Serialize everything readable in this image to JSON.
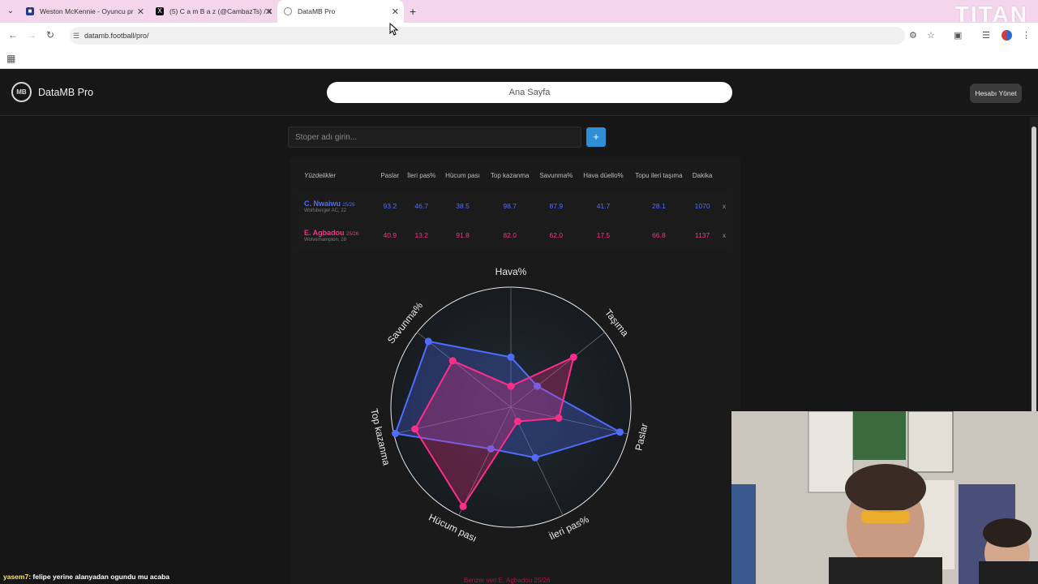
{
  "browser": {
    "tabs": [
      {
        "title": "Weston McKennie - Oyuncu pr",
        "active": false
      },
      {
        "title": "(5) C a m B a z (@CambazTs) / X",
        "active": false
      },
      {
        "title": "DataMB Pro",
        "active": true
      }
    ],
    "url": "datamb.football/pro/",
    "watermark": "TITAN"
  },
  "app": {
    "brand": "DataMB Pro",
    "logo_text": "MB",
    "home_button": "Ana Sayfa",
    "account_button": "Hesabı Yönet",
    "search_placeholder": "Stoper adı girin...",
    "add_button": "+"
  },
  "table": {
    "header_first": "Yüzdelikler",
    "columns": [
      "Paslar",
      "İleri pas%",
      "Hücum pası",
      "Top kazanma",
      "Savunma%",
      "Hava düello%",
      "Topu ileri taşıma",
      "Dakika"
    ],
    "players": [
      {
        "name": "C. Nwaiwu",
        "season": "25/26",
        "club": "Wolfsberger AC, 22",
        "values": [
          "93.2",
          "46.7",
          "38.5",
          "98.7",
          "87.9",
          "41.7",
          "28.1",
          "1070"
        ],
        "color": "#4f6cff"
      },
      {
        "name": "E. Agbadou",
        "season": "25/26",
        "club": "Wolverhampton, 28",
        "values": [
          "40.9",
          "13.2",
          "91.8",
          "82.0",
          "62.0",
          "17.5",
          "66.8",
          "1137"
        ],
        "color": "#ff2d8a"
      }
    ],
    "remove_label": "x"
  },
  "chart_data": {
    "type": "radar",
    "axes": [
      "Hava%",
      "Taşıma",
      "Paslar",
      "İleri pas%",
      "Hücum pası",
      "Top kazanma",
      "Savunma%"
    ],
    "series": [
      {
        "name": "C. Nwaiwu",
        "values": [
          41.7,
          28.1,
          93.2,
          46.7,
          38.5,
          98.7,
          87.9
        ],
        "color": "#4f6cff"
      },
      {
        "name": "E. Agbadou",
        "values": [
          17.5,
          66.8,
          40.9,
          13.2,
          91.8,
          82.0,
          62.0
        ],
        "color": "#ff2d8a"
      }
    ],
    "range": [
      0,
      100
    ]
  },
  "footer_note": "Benzer veri E. Agbadou 25/26",
  "chat": {
    "user": "yasem7",
    "message": ": felipe yerine alanyadan ogundu mu acaba"
  }
}
